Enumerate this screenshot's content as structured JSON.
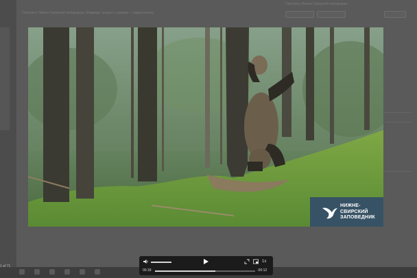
{
  "viewer": {
    "page_indicator": "1 of 71",
    "top_text": "Смотреть Нижне-Свирский заповедник. Медведь танцует у дерева — видеозапись",
    "right_title": "Смотреть Нижне-Свирский заповедник"
  },
  "video": {
    "watermark_lines": "НИЖНЕ-\nСВИРСКИЙ\nЗАПОВЕДНИК",
    "logo_icon": "bird-logo-icon",
    "logo_bg": "#344d68"
  },
  "player": {
    "current_time": "00:18",
    "remaining_time": "-00:12",
    "speed_label": "1x",
    "progress_fraction": 0.6,
    "volume_fraction": 0.9,
    "icons": [
      "volume-icon",
      "play-icon",
      "fullscreen-icon",
      "pip-icon"
    ]
  }
}
